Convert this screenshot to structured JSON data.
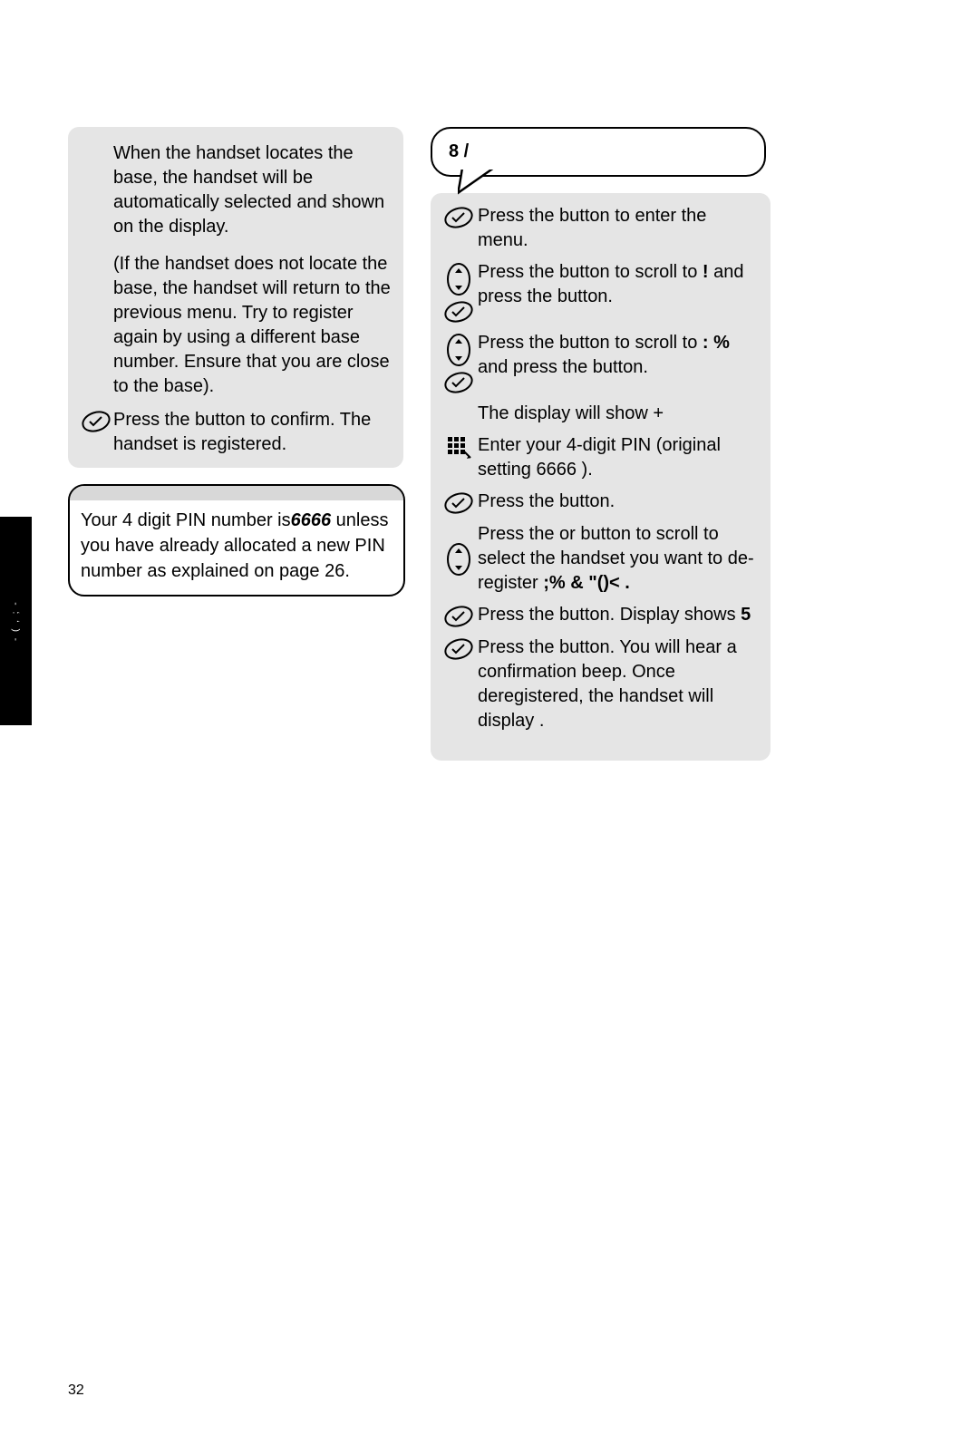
{
  "side_tab": "- ( , ; -",
  "page_number": "32",
  "left": {
    "intro1": "When the handset locates the base, the handset will be automatically selected and shown on the display.",
    "intro2": "(If the handset does not locate the base, the handset will return to the previous menu. Try to register again by using a different base number. Ensure that you are close to the base).",
    "step1_a": "Press the ",
    "step1_b": " button to confirm. The handset is registered.",
    "tip_title": " ",
    "tip_body_a": "Your 4 digit PIN number is",
    "tip_pin": "6666",
    "tip_body_b": " unless you have already allocated a new PIN number as explained on page 26."
  },
  "right": {
    "callout_title": "8   /",
    "s1_a": "Press the ",
    "s1_b": " button to enter the menu.",
    "s2_a": "Press the ",
    "s2_b": " button to scroll to ",
    "s2_c": "!",
    "s2_d": " and press the ",
    "s2_e": " button.",
    "s3_a": "Press the ",
    "s3_b": " button to scroll to ",
    "s3_c": ":  %",
    "s3_d": " and press the ",
    "s3_e": " button.",
    "s4": "The display will show +",
    "s5": "Enter your 4-digit PIN (original setting 6666 ).",
    "s6_a": "Press the ",
    "s6_b": " button.",
    "s7_a": "Press the ",
    "s7_b": " or ",
    "s7_c": " button to scroll to select the handset you want to de-register ",
    "s7_d": ";%   &   \"()<   .",
    "s8_a": "Press the ",
    "s8_b": " button. Display shows",
    "s8_c": "5",
    "s9_a": "Press the ",
    "s9_b": " button. You will hear a confirmation beep. Once deregistered, the handset will display ",
    "s9_c": "."
  }
}
